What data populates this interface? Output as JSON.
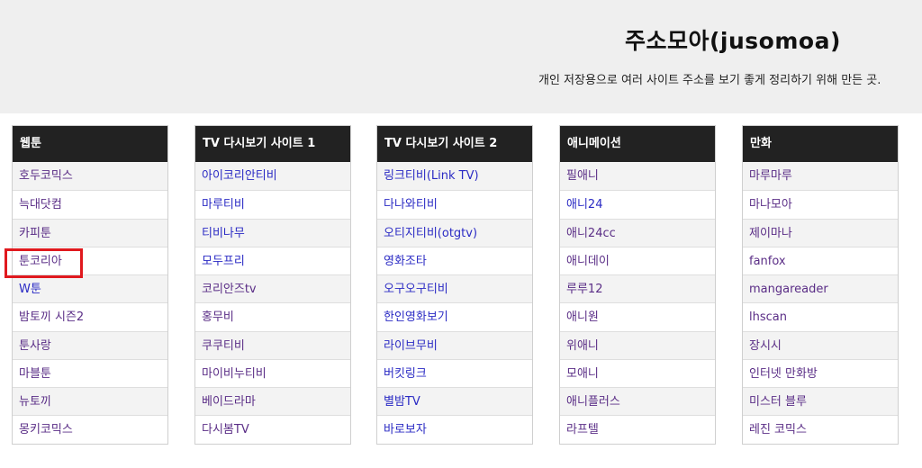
{
  "header": {
    "title": "주소모아(jusomoa)",
    "description": "개인 저장용으로 여러 사이트 주소를 보기 좋게 정리하기 위해 만든 곳."
  },
  "colors": {
    "header_bg": "#efefef",
    "column_header_bg": "#222222",
    "visited_link": "#5a2d86",
    "link": "#2a2ac4",
    "highlight": "#e0191e"
  },
  "columns": [
    {
      "title": "웹툰",
      "items": [
        "호두코믹스",
        "늑대닷컴",
        "카피툰",
        "툰코리아",
        "W툰",
        "밤토끼 시즌2",
        "툰사랑",
        "마블툰",
        "뉴토끼",
        "몽키코믹스"
      ]
    },
    {
      "title": "TV 다시보기 사이트 1",
      "items": [
        "아이코리안티비",
        "마루티비",
        "티비나무",
        "모두프리",
        "코리안즈tv",
        "홍무비",
        "쿠쿠티비",
        "마이비누티비",
        "베이드라마",
        "다시봄TV"
      ]
    },
    {
      "title": "TV 다시보기 사이트 2",
      "items": [
        "링크티비(Link TV)",
        "다나와티비",
        "오티지티비(otgtv)",
        "영화조타",
        "오구오구티비",
        "한인영화보기",
        "라이브무비",
        "버킷링크",
        "별밤TV",
        "바로보자"
      ]
    },
    {
      "title": "애니메이션",
      "items": [
        "필애니",
        "애니24",
        "애니24cc",
        "애니데이",
        "루루12",
        "애니원",
        "위애니",
        "모애니",
        "애니플러스",
        "라프텔"
      ]
    },
    {
      "title": "만화",
      "items": [
        "마루마루",
        "마나모아",
        "제이마나",
        "fanfox",
        "mangareader",
        "lhscan",
        "장시시",
        "인터넷 만화방",
        "미스터 블루",
        "레진 코믹스"
      ]
    }
  ],
  "highlighted_item": "툰코리아"
}
